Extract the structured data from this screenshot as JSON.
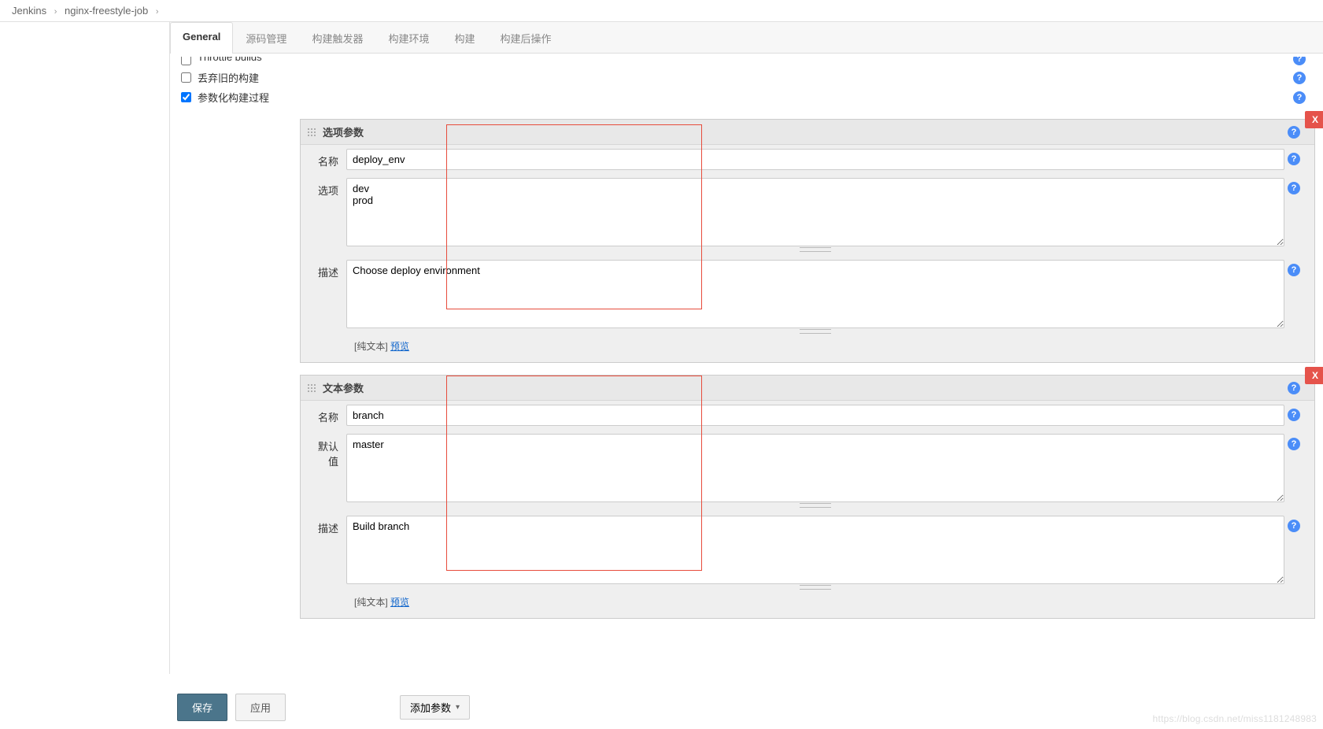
{
  "breadcrumb": {
    "root": "Jenkins",
    "job": "nginx-freestyle-job"
  },
  "tabs": [
    "General",
    "源码管理",
    "构建触发器",
    "构建环境",
    "构建",
    "构建后操作"
  ],
  "options": {
    "throttle": {
      "label": "Throttle builds",
      "checked": false
    },
    "discard": {
      "label": "丢弃旧的构建",
      "checked": false
    },
    "parametrize": {
      "label": "参数化构建过程",
      "checked": true
    }
  },
  "labels": {
    "name": "名称",
    "choices": "选项",
    "description": "描述",
    "default": "默认值",
    "plaintext": "[纯文本]",
    "preview": "预览",
    "add_param": "添加参数",
    "save": "保存",
    "apply": "应用",
    "delete": "X"
  },
  "params": [
    {
      "type_label": "选项参数",
      "name": "deploy_env",
      "choices": "dev\nprod",
      "description": "Choose deploy environment"
    },
    {
      "type_label": "文本参数",
      "name": "branch",
      "default": "master",
      "description": "Build branch"
    }
  ],
  "watermark": "https://blog.csdn.net/miss1181248983"
}
